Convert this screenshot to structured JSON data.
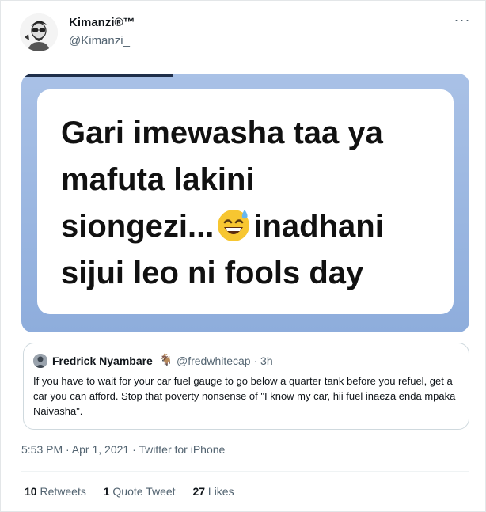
{
  "tweet": {
    "display_name": "Kimanzi®™",
    "handle": "@Kimanzi_",
    "more_icon": "ellipsis-icon",
    "timestamp": "5:53 PM · Apr 1, 2021 · Twitter for iPhone"
  },
  "meme": {
    "line1": "Gari imewasha taa ya",
    "line2": "mafuta lakini",
    "line3_before": "siongezi...",
    "emoji": "grinning-sweat-emoji",
    "line3_after": "inadhani",
    "line4": "sijui leo ni fools day"
  },
  "quoted_tweet": {
    "display_name": "Fredrick Nyambare",
    "name_emoji": "🐐",
    "handle_time": "@fredwhitecap · 3h",
    "text": "If you have to wait for your car fuel gauge to go below a quarter tank before you refuel, get a car you can afford. Stop that poverty nonsense of \"I know my car, hii fuel inaeza enda mpaka Naivasha\"."
  },
  "stats": {
    "retweets_count": "10",
    "retweets_label": "Retweets",
    "quotes_count": "1",
    "quotes_label": "Quote Tweet",
    "likes_count": "27",
    "likes_label": "Likes"
  }
}
